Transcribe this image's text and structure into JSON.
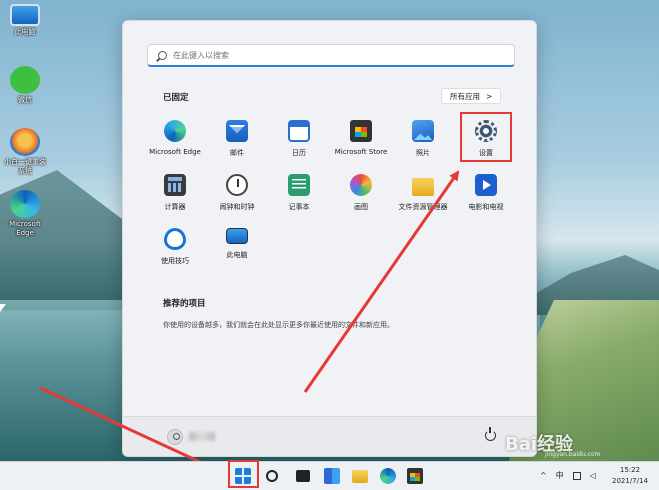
{
  "desktop": {
    "icons": [
      {
        "label": "此电脑",
        "icon": "computer-icon"
      },
      {
        "label": "微信",
        "icon": "wechat-icon"
      },
      {
        "label": "小白一键重装系统",
        "icon": "installer-icon"
      },
      {
        "label": "Microsoft Edge",
        "icon": "edge-icon"
      }
    ]
  },
  "start_menu": {
    "search_placeholder": "在此键入以搜索",
    "pinned_title": "已固定",
    "all_apps_label": "所有应用",
    "all_apps_chevron": ">",
    "apps": [
      {
        "label": "Microsoft Edge",
        "icon": "edge-icon"
      },
      {
        "label": "邮件",
        "icon": "mail-icon"
      },
      {
        "label": "日历",
        "icon": "calendar-icon"
      },
      {
        "label": "Microsoft Store",
        "icon": "store-icon"
      },
      {
        "label": "照片",
        "icon": "photos-icon"
      },
      {
        "label": "设置",
        "icon": "settings-gear-icon"
      },
      {
        "label": "计算器",
        "icon": "calculator-icon"
      },
      {
        "label": "闹钟和时钟",
        "icon": "clock-icon"
      },
      {
        "label": "记事本",
        "icon": "notepad-icon"
      },
      {
        "label": "画图",
        "icon": "paint-icon"
      },
      {
        "label": "文件资源管理器",
        "icon": "file-explorer-icon"
      },
      {
        "label": "电影和电视",
        "icon": "movies-icon"
      },
      {
        "label": "使用技巧",
        "icon": "tips-icon"
      },
      {
        "label": "此电脑",
        "icon": "this-pc-icon"
      }
    ],
    "recommended_title": "推荐的项目",
    "recommended_desc": "你使用的设备越多，我们就会在此处显示更多你最近使用的文件和新应用。"
  },
  "taskbar": {
    "icons": [
      "start-icon",
      "search-icon",
      "task-view-icon",
      "widgets-icon",
      "file-explorer-icon",
      "edge-icon",
      "store-icon"
    ],
    "tray": {
      "chevron": "^",
      "ime": "中"
    },
    "time": "15:22",
    "date": "2021/7/14"
  },
  "watermark": {
    "text": "Bai经验",
    "sub": "jingyan.baidu.com"
  },
  "colors": {
    "highlight": "#e53935",
    "accent": "#1a7de0"
  }
}
